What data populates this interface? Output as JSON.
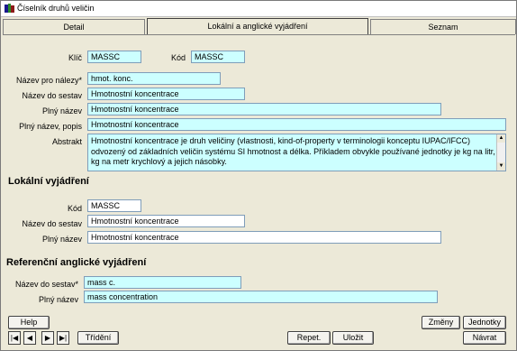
{
  "window": {
    "title": "Číselník druhů veličin"
  },
  "tabs": [
    "Detail",
    "Lokální a anglické vyjádření",
    "Seznam"
  ],
  "header": {
    "key_label": "Klíč",
    "key_value": "MASSC",
    "code_label": "Kód",
    "code_value": "MASSC",
    "finding_name_label": "Název pro nálezy*",
    "finding_name_value": "hmot. konc.",
    "report_name_label": "Název do sestav",
    "report_name_value": "Hmotnostní koncentrace",
    "full_name_label": "Plný název",
    "full_name_value": "Hmotnostní koncentrace",
    "full_desc_label": "Plný název, popis",
    "full_desc_value": "Hmotnostní koncentrace",
    "abstract_label": "Abstrakt",
    "abstract_value": "Hmotnostní koncentrace je druh veličiny (vlastnosti, kind-of-property v terminologii konceptu IUPAC/IFCC) odvozený od základních veličin systému SI hmotnost a délka. Příkladem obvykle používané jednotky je kg na litr, kg na metr krychlový a jejich násobky."
  },
  "local": {
    "heading": "Lokální vyjádření",
    "code_label": "Kód",
    "code_value": "MASSC",
    "report_name_label": "Název do sestav",
    "report_name_value": "Hmotnostní koncentrace",
    "full_name_label": "Plný název",
    "full_name_value": "Hmotnostní koncentrace"
  },
  "english": {
    "heading": "Referenční anglické vyjádření",
    "report_name_label": "Název do sestav*",
    "report_name_value": "mass c.",
    "full_name_label": "Plný název",
    "full_name_value": "mass concentration"
  },
  "buttons": {
    "help": "Help",
    "changes": "Změny",
    "units": "Jednotky",
    "sort": "Třídění",
    "repeat": "Repet.",
    "save": "Uložit",
    "back": "Návrat"
  },
  "nav": {
    "first": "|◀",
    "prev": "◀",
    "next": "▶",
    "last": "▶|"
  },
  "colors": {
    "field_bg": "#ccffff",
    "window_bg": "#ece9d8"
  }
}
